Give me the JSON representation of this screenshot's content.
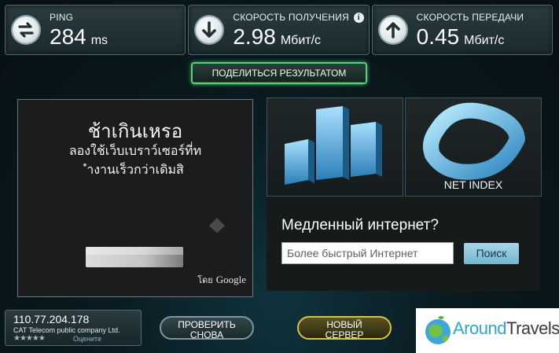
{
  "metrics": [
    {
      "label": "PING",
      "value": "284",
      "unit": "ms",
      "icon": "sync-arrows-icon"
    },
    {
      "label": "СКОРОСТЬ ПОЛУЧЕНИЯ",
      "value": "2.98",
      "unit": "Мбит/с",
      "icon": "download-arrow-icon",
      "info": "i"
    },
    {
      "label": "СКОРОСТЬ ПЕРЕДАЧИ",
      "value": "0.45",
      "unit": "Мбит/с",
      "icon": "upload-arrow-icon"
    }
  ],
  "share_label": "ПОДЕЛИТЬСЯ РЕЗУЛЬТАТОМ",
  "ad": {
    "line1": "ช้าเกินเหรอ",
    "line2": "ลองใช้เว็บเบราว์เซอร์ที่ท",
    "line3": "ำงานเร็วกว่าเดิมสิ",
    "by_label": "โดย",
    "brand": "Google"
  },
  "net_index_label": "NET INDEX",
  "slow": {
    "question": "Медленный интернет?",
    "input_value": "Более быстрый Интернет",
    "search_label": "Поиск"
  },
  "connection": {
    "ip": "110.77.204.178",
    "isp": "CAT Telecom public company Ltd.",
    "stars": "★★★★★",
    "rate_label": "Оцените"
  },
  "buttons": {
    "retest": [
      "ПРОВЕРИТЬ",
      "СНОВА"
    ],
    "new_server": [
      "НОВЫЙ",
      "СЕРВЕР"
    ]
  },
  "logo": {
    "part1": "Around",
    "part2": "Travels"
  },
  "colors": {
    "accent_green": "#59d07a",
    "server_gold": "#d8c14a",
    "search_blue": "#72b7d1",
    "logo_blue": "#2fa7cc"
  }
}
